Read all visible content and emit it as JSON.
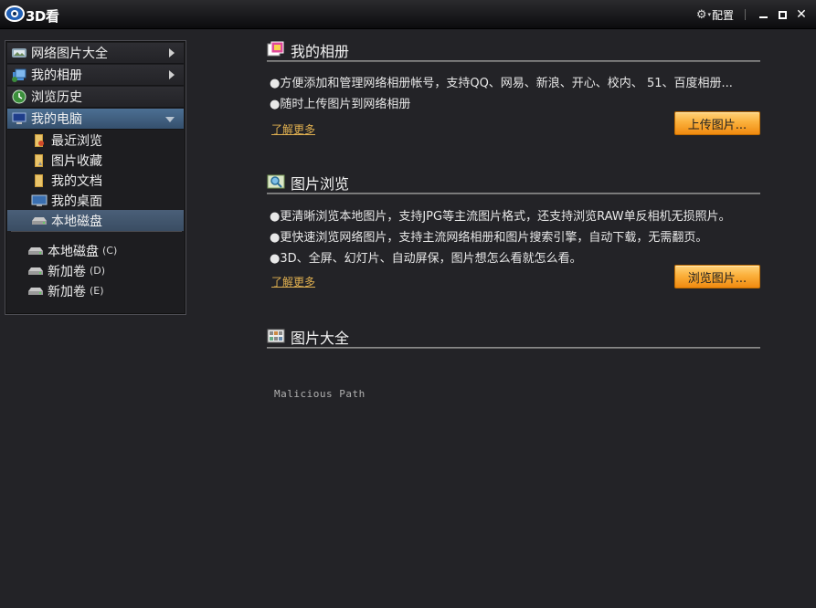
{
  "app": {
    "title": "3D看"
  },
  "titlebar": {
    "config_label": "配置",
    "icons": {
      "settings": "gear-icon",
      "minimize": "minimize-icon",
      "maximize": "maximize-icon",
      "close": "close-icon"
    }
  },
  "sidebar": {
    "top_items": [
      {
        "label": "网络图片大全",
        "icon": "web-photos-icon",
        "has_arrow": true
      },
      {
        "label": "我的相册",
        "icon": "album-icon",
        "has_arrow": true
      },
      {
        "label": "浏览历史",
        "icon": "history-icon",
        "has_arrow": false
      },
      {
        "label": "我的电脑",
        "icon": "computer-icon",
        "expanded": true
      }
    ],
    "sub_items": [
      {
        "label": "最近浏览",
        "icon": "recent-folder-icon"
      },
      {
        "label": "图片收藏",
        "icon": "favorites-folder-icon"
      },
      {
        "label": "我的文档",
        "icon": "documents-folder-icon"
      },
      {
        "label": "我的桌面",
        "icon": "desktop-icon"
      },
      {
        "label": "本地磁盘",
        "icon": "disk-icon",
        "selected": true
      }
    ],
    "drives": [
      {
        "label": "本地磁盘",
        "letter": "(C)"
      },
      {
        "label": "新加卷",
        "letter": "(D)"
      },
      {
        "label": "新加卷",
        "letter": "(E)"
      }
    ]
  },
  "sections": {
    "album": {
      "title": "我的相册",
      "bullets": [
        "●方便添加和管理网络相册帐号，支持QQ、网易、新浪、开心、校内、 51、百度相册...",
        "●随时上传图片到网络相册"
      ],
      "more_link": "了解更多",
      "button": "上传图片..."
    },
    "browse": {
      "title": "图片浏览",
      "bullets": [
        "●更清晰浏览本地图片，支持JPG等主流图片格式，还支持浏览RAW单反相机无损照片。",
        "●更快速浏览网络图片，支持主流网络相册和图片搜索引擎，自动下载，无需翻页。",
        "●3D、全屏、幻灯片、自动屏保，图片想怎么看就怎么看。"
      ],
      "more_link": "了解更多",
      "button": "浏览图片..."
    },
    "gallery": {
      "title": "图片大全",
      "path_text": "Malicious Path"
    }
  },
  "colors": {
    "background": "#232327",
    "accent_button": "#fbb03b",
    "link": "#e0b050",
    "selection": "#4c6f93"
  }
}
